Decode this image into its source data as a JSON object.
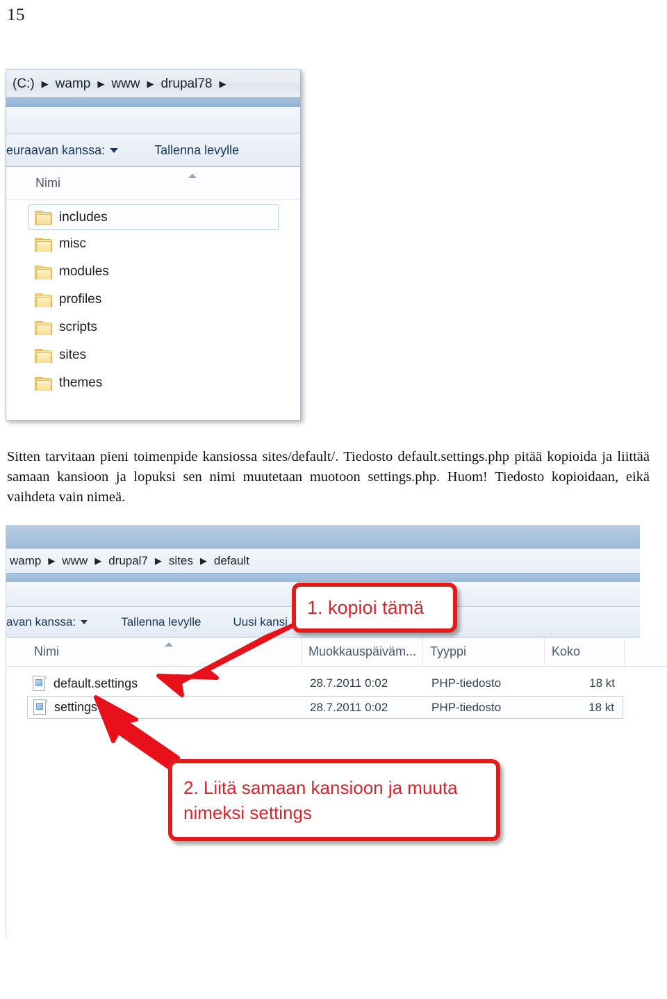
{
  "page": {
    "number": "15"
  },
  "screenshot_top": {
    "breadcrumb": [
      "(C:)",
      "wamp",
      "www",
      "drupal78"
    ],
    "breadcrumb_separator": "▶",
    "toolbar": {
      "open_with_label": "euraavan kanssa:",
      "burn_label": "Tallenna levylle"
    },
    "columns": [
      "Nimi"
    ],
    "rows": [
      {
        "name": "includes",
        "icon": "folder-icon",
        "selected": true
      },
      {
        "name": "misc",
        "icon": "folder-icon",
        "selected": false
      },
      {
        "name": "modules",
        "icon": "folder-icon",
        "selected": false
      },
      {
        "name": "profiles",
        "icon": "folder-icon",
        "selected": false
      },
      {
        "name": "scripts",
        "icon": "folder-icon",
        "selected": false
      },
      {
        "name": "sites",
        "icon": "folder-icon",
        "selected": false
      },
      {
        "name": "themes",
        "icon": "folder-icon",
        "selected": false
      }
    ]
  },
  "paragraph": {
    "text": "Sitten tarvitaan pieni toimenpide kansiossa sites/default/. Tiedosto default.settings.php pitää kopioida ja liittää samaan kansioon ja lopuksi sen nimi muutetaan muotoon settings.php. Huom! Tiedosto kopioidaan, eikä vaihdeta vain nimeä."
  },
  "screenshot_bottom": {
    "breadcrumb": [
      "wamp",
      "www",
      "drupal7",
      "sites",
      "default"
    ],
    "breadcrumb_separator": "▶",
    "toolbar": {
      "open_with_label": "avan kanssa:",
      "burn_label": "Tallenna levylle",
      "new_folder_label": "Uusi kansi"
    },
    "columns": [
      "Nimi",
      "Muokkauspäiväm...",
      "Tyyppi",
      "Koko"
    ],
    "rows": [
      {
        "name": "default.settings",
        "icon": "php-file-icon",
        "modified": "28.7.2011 0:02",
        "type": "PHP-tiedosto",
        "size": "18 kt",
        "selected": false
      },
      {
        "name": "settings",
        "icon": "php-file-icon",
        "modified": "28.7.2011 0:02",
        "type": "PHP-tiedosto",
        "size": "18 kt",
        "selected": true
      }
    ],
    "callouts": [
      {
        "id": "callout-1",
        "text": "1. kopioi tämä"
      },
      {
        "id": "callout-2",
        "text": "2. Liitä samaan kansioon ja muuta\nnimeksi settings"
      }
    ]
  },
  "colors": {
    "callout_red": "#e41b1b",
    "callout_text_red": "#d6262b",
    "arrow_red": "#e8111a",
    "chrome_blue": "#8fb4d6"
  }
}
